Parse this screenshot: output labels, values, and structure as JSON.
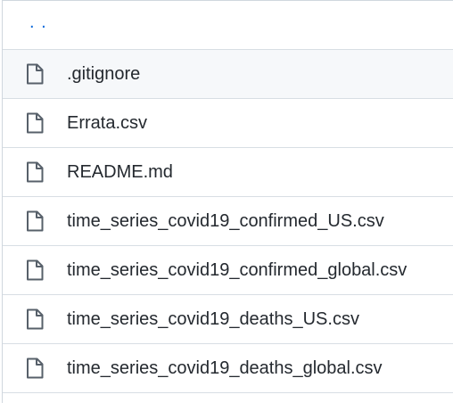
{
  "parent_link": {
    "label": ". ."
  },
  "files": [
    {
      "name": ".gitignore",
      "icon": "file-icon"
    },
    {
      "name": "Errata.csv",
      "icon": "file-icon"
    },
    {
      "name": "README.md",
      "icon": "file-icon"
    },
    {
      "name": "time_series_covid19_confirmed_US.csv",
      "icon": "file-icon"
    },
    {
      "name": "time_series_covid19_confirmed_global.csv",
      "icon": "file-icon"
    },
    {
      "name": "time_series_covid19_deaths_US.csv",
      "icon": "file-icon"
    },
    {
      "name": "time_series_covid19_deaths_global.csv",
      "icon": "file-icon"
    }
  ],
  "colors": {
    "border": "#d0d7de",
    "text": "#24292f",
    "link": "#0969da",
    "icon": "#57606a",
    "hover_bg": "#f6f8fa"
  }
}
